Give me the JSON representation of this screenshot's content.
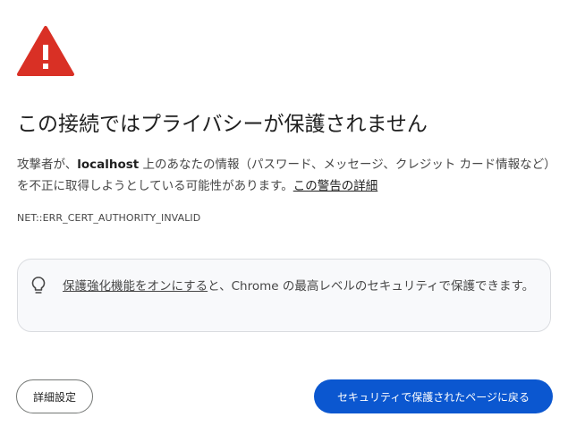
{
  "title": "この接続ではプライバシーが保護されません",
  "message": {
    "prefix": "攻撃者が、",
    "host": "localhost",
    "suffix": " 上のあなたの情報（パスワード、メッセージ、クレジット カード情報など）を不正に取得しようとしている可能性があります。",
    "details_link": "この警告の詳細"
  },
  "error_code": "NET::ERR_CERT_AUTHORITY_INVALID",
  "enhanced_protection": {
    "link": "保護強化機能をオンにする",
    "text": "と、Chrome の最高レベルのセキュリティで保護できます。"
  },
  "buttons": {
    "advanced": "詳細設定",
    "back_to_safety": "セキュリティで保護されたページに戻る"
  },
  "icons": {
    "warning": "warning-triangle-icon",
    "enhanced": "lightbulb-icon"
  },
  "colors": {
    "warning_red": "#d93025",
    "primary_blue": "#0b57d0",
    "card_background": "#f8f9fb"
  }
}
